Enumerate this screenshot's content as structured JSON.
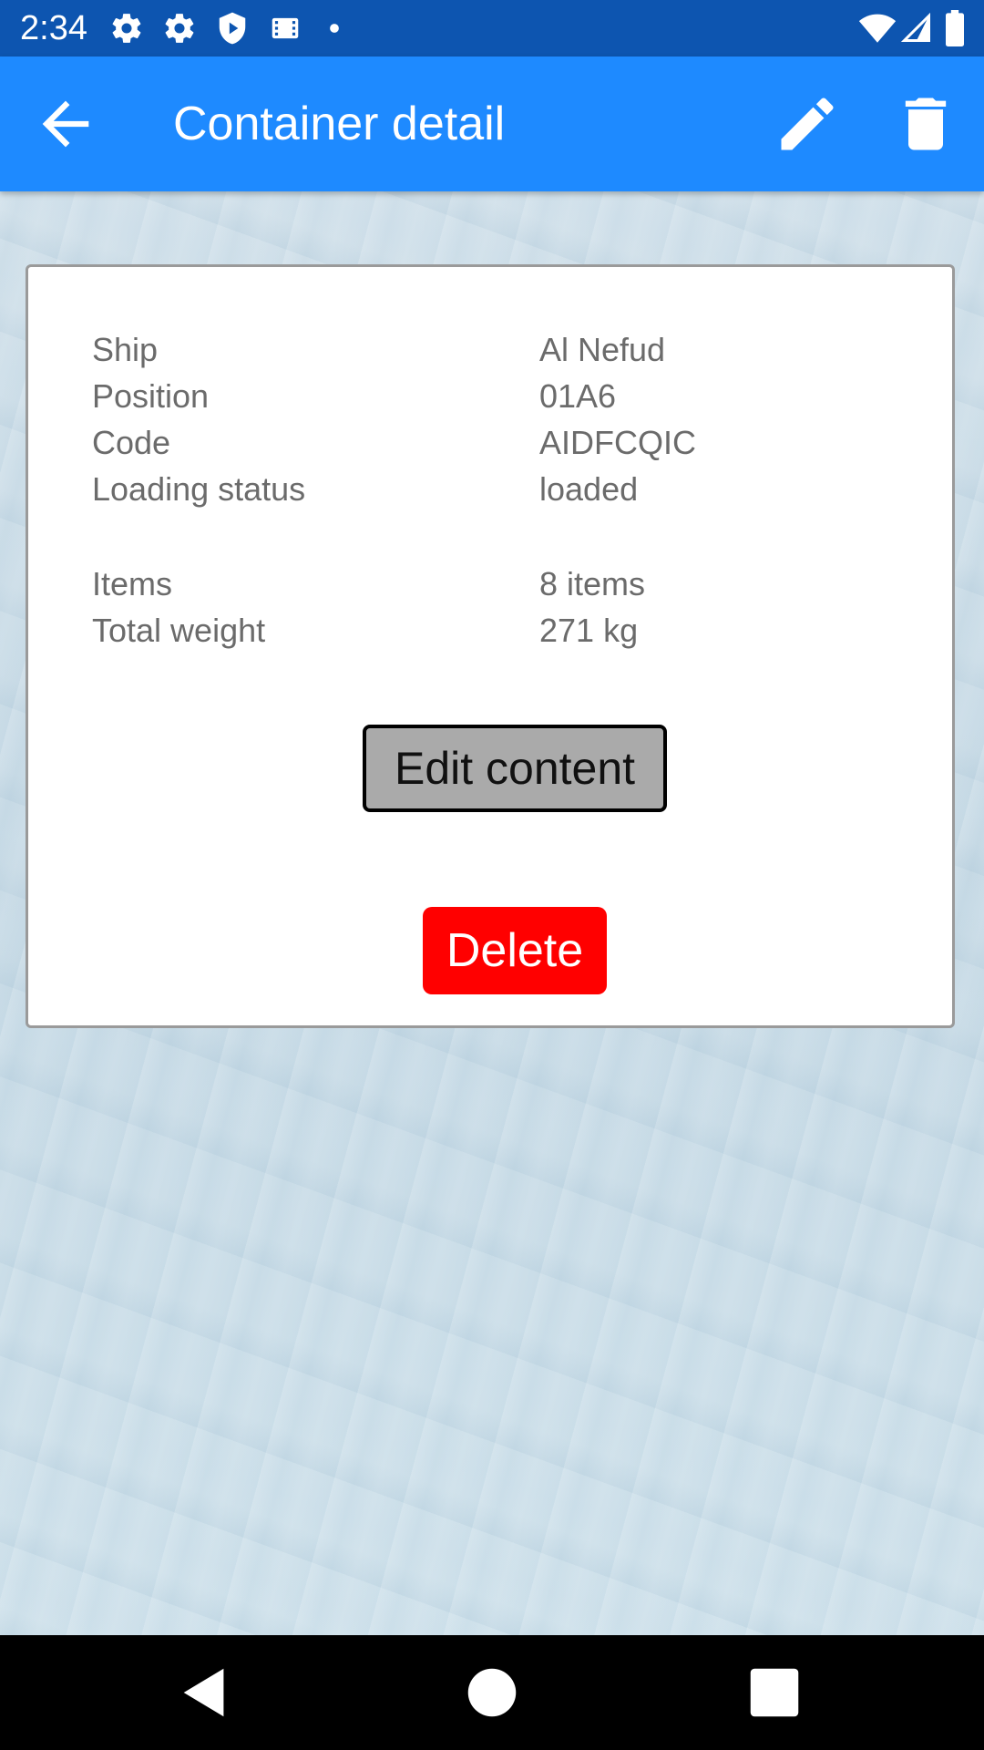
{
  "status_bar": {
    "time": "2:34",
    "icons": [
      "settings-gear-icon",
      "settings-gear-icon",
      "shield-icon",
      "film-icon",
      "notification-dot-icon",
      "wifi-icon",
      "cell-signal-icon",
      "battery-icon"
    ]
  },
  "app_bar": {
    "title": "Container detail",
    "back_icon": "arrow-back-icon",
    "edit_icon": "pencil-icon",
    "delete_icon": "trash-icon"
  },
  "details": {
    "rows": [
      {
        "label": "Ship",
        "value": "Al Nefud"
      },
      {
        "label": "Position",
        "value": "01A6"
      },
      {
        "label": "Code",
        "value": "AIDFCQIC"
      },
      {
        "label": "Loading status",
        "value": "loaded"
      }
    ],
    "summary_rows": [
      {
        "label": "Items",
        "value": "8 items"
      },
      {
        "label": "Total weight",
        "value": "271 kg"
      }
    ]
  },
  "actions": {
    "edit_content_label": "Edit content",
    "delete_label": "Delete"
  },
  "colors": {
    "status_bar": "#0d55b0",
    "app_bar": "#1e8aff",
    "delete_button": "#ff0000",
    "edit_content_button": "#aaaaaa",
    "detail_text": "#6b6b6b"
  },
  "nav_bar": {
    "icons": [
      "nav-back-icon",
      "nav-home-icon",
      "nav-recents-icon"
    ]
  }
}
